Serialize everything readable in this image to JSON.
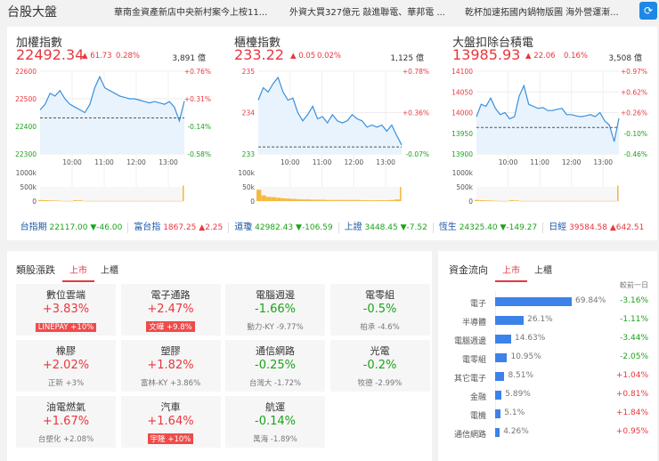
{
  "header": {
    "title": "台股大盤",
    "news": [
      "華南金資產新店中央新村案今上桉11...",
      "外資大買327億元 敲進聯電、華邦電 ...",
      "乾杯加速拓國內鍋物版圖 海外營運漸..."
    ],
    "refresh_icon": "refresh-icon"
  },
  "indices": [
    {
      "name": "加權指數",
      "price": "22492.34",
      "change": "▲ 61.73",
      "pct": "0.28%",
      "volume": "3,891 億"
    },
    {
      "name": "櫃檯指數",
      "price": "233.22",
      "change": "▲ 0.05",
      "pct": "0.02%",
      "volume": "1,125 億"
    },
    {
      "name": "大盤扣除台積電",
      "price": "13985.93",
      "change": "▲ 22.06",
      "pct": "0.16%",
      "volume": "3,508 億"
    }
  ],
  "chart_data": [
    {
      "type": "line",
      "title": "加權指數",
      "x_ticks": [
        "10:00",
        "11:00",
        "12:00",
        "13:00"
      ],
      "x_range_minutes": [
        0,
        270
      ],
      "ylim": [
        22300,
        22600
      ],
      "y_ticks": [
        "22600",
        "22500",
        "22400",
        "22300"
      ],
      "y_tick_dirs": [
        "up",
        "up",
        "dn",
        "dn"
      ],
      "pct_ticks": [
        "+0.76%",
        "+0.31%",
        "-0.14%",
        "-0.58%"
      ],
      "prev_close": 22430.6,
      "values": [
        22460,
        22480,
        22520,
        22510,
        22530,
        22500,
        22480,
        22470,
        22460,
        22450,
        22480,
        22540,
        22580,
        22540,
        22530,
        22520,
        22510,
        22505,
        22500,
        22500,
        22495,
        22490,
        22485,
        22490,
        22485,
        22480,
        22490,
        22470,
        22420,
        22492
      ],
      "volume_ticks": [
        "1000k",
        "500k",
        "0"
      ],
      "volume_max": 1000,
      "volume": [
        40,
        30,
        25,
        20,
        10,
        5,
        5,
        30,
        25,
        5,
        5,
        5,
        5,
        5,
        5,
        5,
        5,
        5,
        5,
        5,
        5,
        5,
        5,
        5,
        5,
        5,
        5,
        5,
        5,
        550
      ]
    },
    {
      "type": "line",
      "title": "櫃檯指數",
      "x_ticks": [
        "10:00",
        "11:00",
        "12:00",
        "13:00"
      ],
      "x_range_minutes": [
        0,
        270
      ],
      "ylim": [
        233,
        235
      ],
      "y_ticks": [
        "235",
        "234",
        "233"
      ],
      "y_tick_dirs": [
        "up",
        "up",
        "dn"
      ],
      "pct_ticks": [
        "+0.78%",
        "+0.36%",
        "-0.07%"
      ],
      "prev_close": 233.17,
      "values": [
        234.3,
        234.6,
        234.5,
        234.7,
        234.85,
        234.5,
        234.3,
        234.35,
        234.0,
        233.8,
        233.95,
        234.15,
        233.85,
        233.9,
        233.75,
        233.95,
        233.8,
        233.75,
        233.8,
        233.95,
        233.85,
        233.8,
        233.65,
        233.7,
        233.65,
        233.7,
        233.55,
        233.7,
        233.45,
        233.22
      ],
      "volume_ticks": [
        "100k",
        "50k",
        "0"
      ],
      "volume_max": 100,
      "volume": [
        40,
        20,
        15,
        14,
        12,
        10,
        9,
        8,
        7,
        6,
        6,
        5,
        5,
        5,
        4,
        4,
        4,
        4,
        4,
        4,
        4,
        3,
        3,
        3,
        3,
        3,
        3,
        4,
        6,
        50
      ]
    },
    {
      "type": "line",
      "title": "大盤扣除台積電",
      "x_ticks": [
        "10:00",
        "11:00",
        "12:00",
        "13:00"
      ],
      "x_range_minutes": [
        0,
        270
      ],
      "ylim": [
        13900,
        14100
      ],
      "y_ticks": [
        "14100",
        "14050",
        "14000",
        "13950",
        "13900"
      ],
      "y_tick_dirs": [
        "up",
        "up",
        "up",
        "dn",
        "dn"
      ],
      "pct_ticks": [
        "+0.97%",
        "+0.62%",
        "+0.26%",
        "-0.10%",
        "-0.46%"
      ],
      "prev_close": 13963.9,
      "values": [
        13990,
        14020,
        14015,
        14035,
        14010,
        13995,
        14000,
        13985,
        13990,
        14040,
        14065,
        14020,
        14015,
        14010,
        14012,
        14005,
        14005,
        14008,
        14010,
        13995,
        13995,
        13992,
        13990,
        13992,
        13995,
        13990,
        14000,
        13980,
        13970,
        13930,
        13986
      ],
      "volume_ticks": [
        "1000k",
        "500k",
        "0"
      ],
      "volume_max": 1000,
      "volume": [
        40,
        30,
        25,
        20,
        10,
        5,
        5,
        30,
        25,
        5,
        5,
        5,
        5,
        5,
        5,
        5,
        5,
        5,
        5,
        5,
        5,
        5,
        5,
        5,
        5,
        5,
        5,
        5,
        5,
        550
      ]
    }
  ],
  "ticker": [
    {
      "name": "台指期",
      "value": "22117.00",
      "change": "▼-46.00",
      "dir": "dn"
    },
    {
      "name": "富台指",
      "value": "1867.25",
      "change": "▲2.25",
      "dir": "up"
    },
    {
      "name": "道瓊",
      "value": "42982.43",
      "change": "▼-106.59",
      "dir": "dn"
    },
    {
      "name": "上證",
      "value": "3448.45",
      "change": "▼-7.52",
      "dir": "dn"
    },
    {
      "name": "恆生",
      "value": "24325.40",
      "change": "▼-149.27",
      "dir": "dn"
    },
    {
      "name": "日經",
      "value": "39584.58",
      "change": "▲642.51",
      "dir": "up"
    }
  ],
  "sectors": {
    "title": "類股漲跌",
    "tabs": [
      "上市",
      "上櫃"
    ],
    "items": [
      {
        "name": "數位雲端",
        "pct": "+3.83%",
        "dir": "up",
        "stock": "LINEPAY  +10%",
        "hot": true
      },
      {
        "name": "電子通路",
        "pct": "+2.47%",
        "dir": "up",
        "stock": "文曄  +9.8%",
        "hot": true
      },
      {
        "name": "電腦週邊",
        "pct": "-1.66%",
        "dir": "dn",
        "stock": "動力-KY  -9.77%",
        "hot": false
      },
      {
        "name": "電零組",
        "pct": "-0.5%",
        "dir": "dn",
        "stock": "柏承  -4.6%",
        "hot": false
      },
      {
        "name": "橡膠",
        "pct": "+2.02%",
        "dir": "up",
        "stock": "正新  +3%",
        "hot": false
      },
      {
        "name": "塑膠",
        "pct": "+1.82%",
        "dir": "up",
        "stock": "富林-KY  +3.86%",
        "hot": false
      },
      {
        "name": "通信網路",
        "pct": "-0.25%",
        "dir": "dn",
        "stock": "台灣大  -1.72%",
        "hot": false
      },
      {
        "name": "光電",
        "pct": "-0.2%",
        "dir": "dn",
        "stock": "牧德  -2.99%",
        "hot": false
      },
      {
        "name": "油電燃氣",
        "pct": "+1.67%",
        "dir": "up",
        "stock": "台塑化  +2.08%",
        "hot": false
      },
      {
        "name": "汽車",
        "pct": "+1.64%",
        "dir": "up",
        "stock": "宇隆  +10%",
        "hot": true
      },
      {
        "name": "航運",
        "pct": "-0.14%",
        "dir": "dn",
        "stock": "萬海  -1.89%",
        "hot": false
      }
    ]
  },
  "fund_flow": {
    "title": "資金流向",
    "tabs": [
      "上市",
      "上櫃"
    ],
    "col_label": "較前一日",
    "items": [
      {
        "name": "電子",
        "share": 69.84,
        "share_label": "69.84%",
        "change": "-3.16%",
        "dir": "dn"
      },
      {
        "name": "半導體",
        "share": 26.1,
        "share_label": "26.1%",
        "change": "-1.11%",
        "dir": "dn"
      },
      {
        "name": "電腦週邊",
        "share": 14.63,
        "share_label": "14.63%",
        "change": "-3.44%",
        "dir": "dn"
      },
      {
        "name": "電零組",
        "share": 10.95,
        "share_label": "10.95%",
        "change": "-2.05%",
        "dir": "dn"
      },
      {
        "name": "其它電子",
        "share": 8.51,
        "share_label": "8.51%",
        "change": "+1.04%",
        "dir": "up"
      },
      {
        "name": "金融",
        "share": 5.89,
        "share_label": "5.89%",
        "change": "+0.81%",
        "dir": "up"
      },
      {
        "name": "電機",
        "share": 5.1,
        "share_label": "5.1%",
        "change": "+1.84%",
        "dir": "up"
      },
      {
        "name": "通信網路",
        "share": 4.26,
        "share_label": "4.26%",
        "change": "+0.95%",
        "dir": "up"
      }
    ]
  }
}
